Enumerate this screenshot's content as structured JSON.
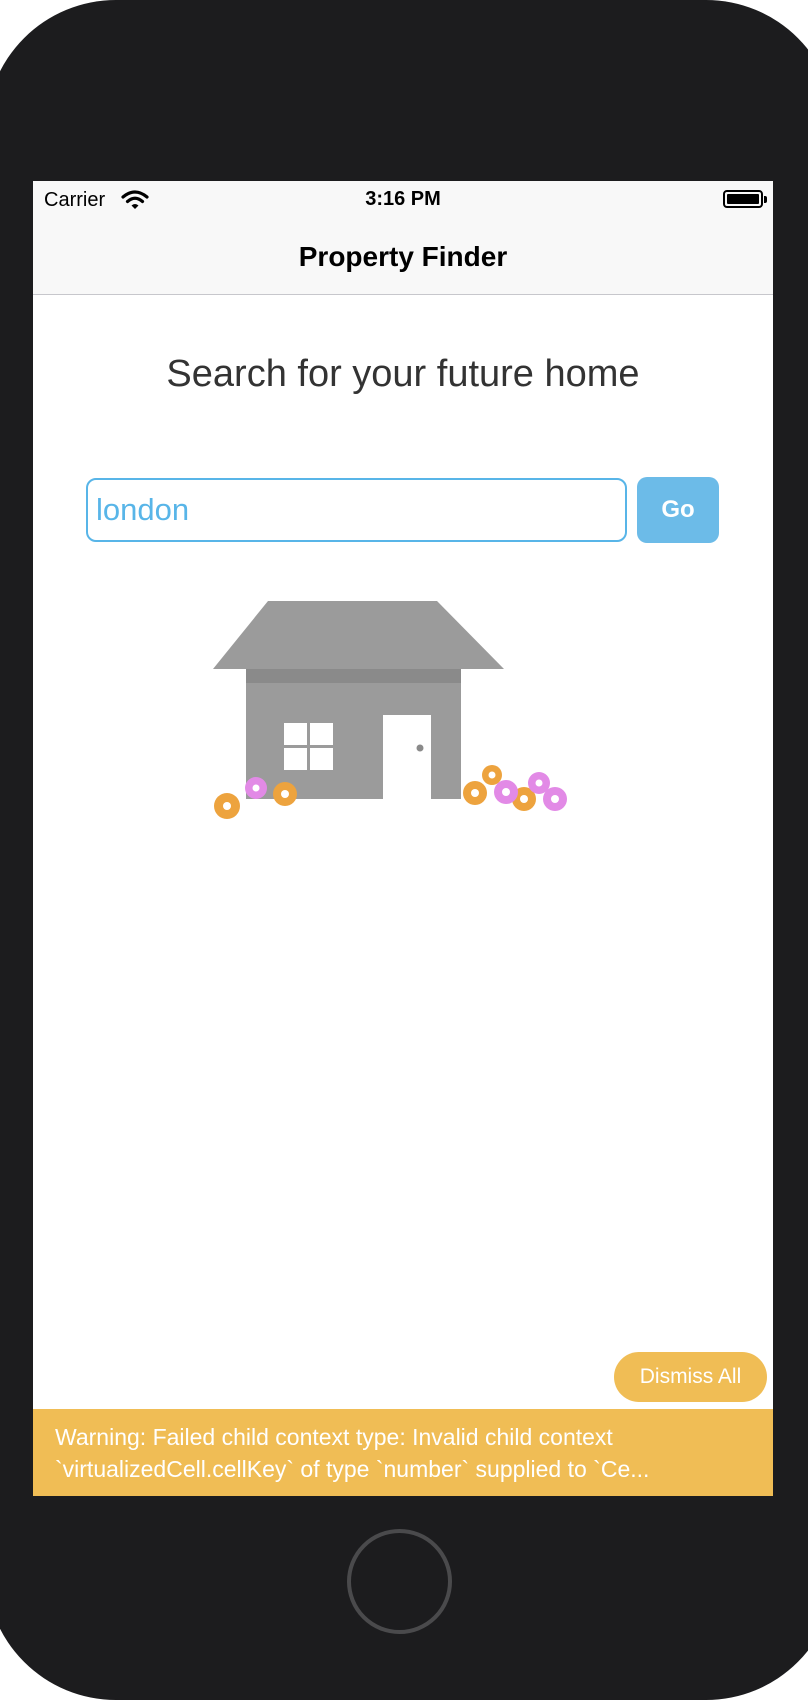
{
  "status_bar": {
    "carrier": "Carrier",
    "time": "3:16 PM"
  },
  "nav": {
    "title": "Property Finder"
  },
  "main": {
    "headline": "Search for your future home",
    "search": {
      "value": "london",
      "placeholder": ""
    },
    "go_label": "Go"
  },
  "debug": {
    "dismiss_label": "Dismiss All",
    "warning_line1": "Warning: Failed child context type: Invalid child context",
    "warning_line2": "`virtualizedCell.cellKey` of type `number` supplied to `Ce..."
  },
  "colors": {
    "accent": "#58b5e8",
    "go_button": "#6cbbe8",
    "warning": "#f0bd55",
    "house": "#9b9b9b",
    "bezel": "#1c1c1e"
  },
  "icons": [
    "wifi-icon",
    "battery-icon",
    "house-illustration",
    "home-button"
  ]
}
